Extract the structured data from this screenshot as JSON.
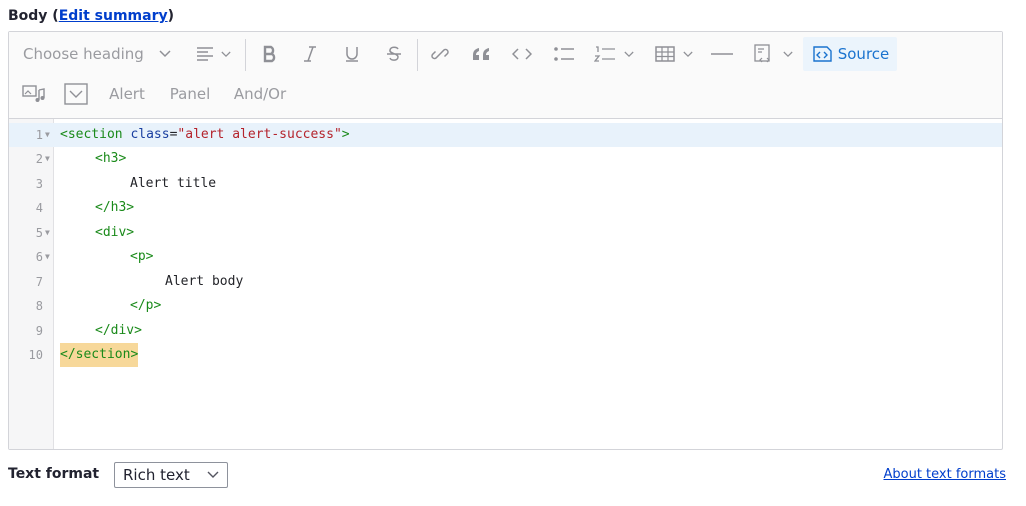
{
  "field": {
    "label_prefix": "Body (",
    "edit_summary_link": "Edit summary",
    "label_suffix": ")"
  },
  "toolbar": {
    "heading_placeholder": "Choose heading",
    "source_label": "Source",
    "row2": {
      "alert": "Alert",
      "panel": "Panel",
      "andor": "And/Or"
    },
    "icons": [
      "align-left-icon",
      "bold-icon",
      "italic-icon",
      "underline-icon",
      "strikethrough-icon",
      "link-icon",
      "blockquote-icon",
      "code-icon",
      "bulleted-list-icon",
      "numbered-list-icon",
      "table-icon",
      "horizontal-line-icon",
      "code-block-icon",
      "source-icon",
      "media-icon",
      "collapse-icon"
    ],
    "accent_color": "#1a73cf"
  },
  "code": {
    "lines": [
      {
        "num": "1",
        "text": "<section class=\"alert alert-success\">"
      },
      {
        "num": "2",
        "text": "<h3>"
      },
      {
        "num": "3",
        "text": "Alert title"
      },
      {
        "num": "4",
        "text": "</h3>"
      },
      {
        "num": "5",
        "text": "<div>"
      },
      {
        "num": "6",
        "text": "<p>"
      },
      {
        "num": "7",
        "text": "Alert body"
      },
      {
        "num": "8",
        "text": "</p>"
      },
      {
        "num": "9",
        "text": "</div>"
      },
      {
        "num": "10",
        "text": "</section>"
      }
    ],
    "tokens": {
      "l1_open": "<section ",
      "l1_attr": "class",
      "l1_eq": "=",
      "l1_str": "\"alert alert-success\"",
      "l1_close": ">"
    }
  },
  "format": {
    "label": "Text format",
    "selected": "Rich text",
    "about_link": "About text formats"
  }
}
